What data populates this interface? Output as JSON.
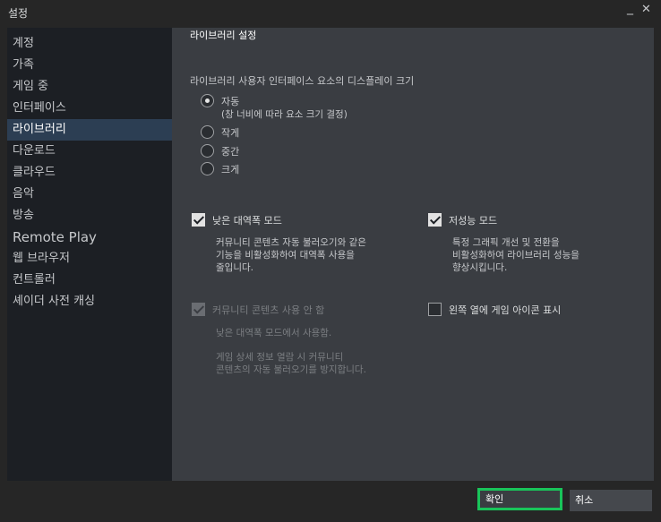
{
  "window": {
    "title": "설정",
    "minimize": "_",
    "close": "✕"
  },
  "sidebar": {
    "items": [
      {
        "label": "계정"
      },
      {
        "label": "가족"
      },
      {
        "label": "게임 중"
      },
      {
        "label": "인터페이스"
      },
      {
        "label": "라이브러리",
        "active": true
      },
      {
        "label": "다운로드"
      },
      {
        "label": "클라우드"
      },
      {
        "label": "음악"
      },
      {
        "label": "방송"
      },
      {
        "label": "Remote Play"
      },
      {
        "label": "웹 브라우저"
      },
      {
        "label": "컨트롤러"
      },
      {
        "label": "셰이더 사전 캐싱"
      }
    ]
  },
  "main": {
    "title": "라이브러리 설정",
    "display_size": {
      "label": "라이브러리 사용자 인터페이스 요소의 디스플레이 크기",
      "options": [
        {
          "label": "자동",
          "sub": "(창 너비에 따라 요소 크기 결정)",
          "selected": true
        },
        {
          "label": "작게",
          "selected": false
        },
        {
          "label": "중간",
          "selected": false
        },
        {
          "label": "크게",
          "selected": false
        }
      ]
    },
    "low_bandwidth": {
      "label": "낮은 대역폭 모드",
      "checked": true,
      "desc": [
        "커뮤니티 콘텐츠 자동 불러오기와 같은",
        "기능을 비활성화하여 대역폭 사용을",
        "줄입니다."
      ]
    },
    "low_perf": {
      "label": "저성능 모드",
      "checked": true,
      "desc": [
        "특정 그래픽 개선 및 전환을",
        "비활성화하여 라이브러리 성능을",
        "향상시킵니다."
      ]
    },
    "no_community": {
      "label": "커뮤니티 콘텐츠 사용 안 함",
      "checked": true,
      "disabled": true,
      "desc1": "낮은 대역폭 모드에서 사용함.",
      "desc2": [
        "게임 상세 정보 열람 시 커뮤니티",
        "콘텐츠의 자동 불러오기를 방지합니다."
      ]
    },
    "left_icons": {
      "label": "왼쪽 열에 게임 아이콘 표시",
      "checked": false
    }
  },
  "footer": {
    "ok_label": "확인",
    "cancel_label": "취소"
  }
}
